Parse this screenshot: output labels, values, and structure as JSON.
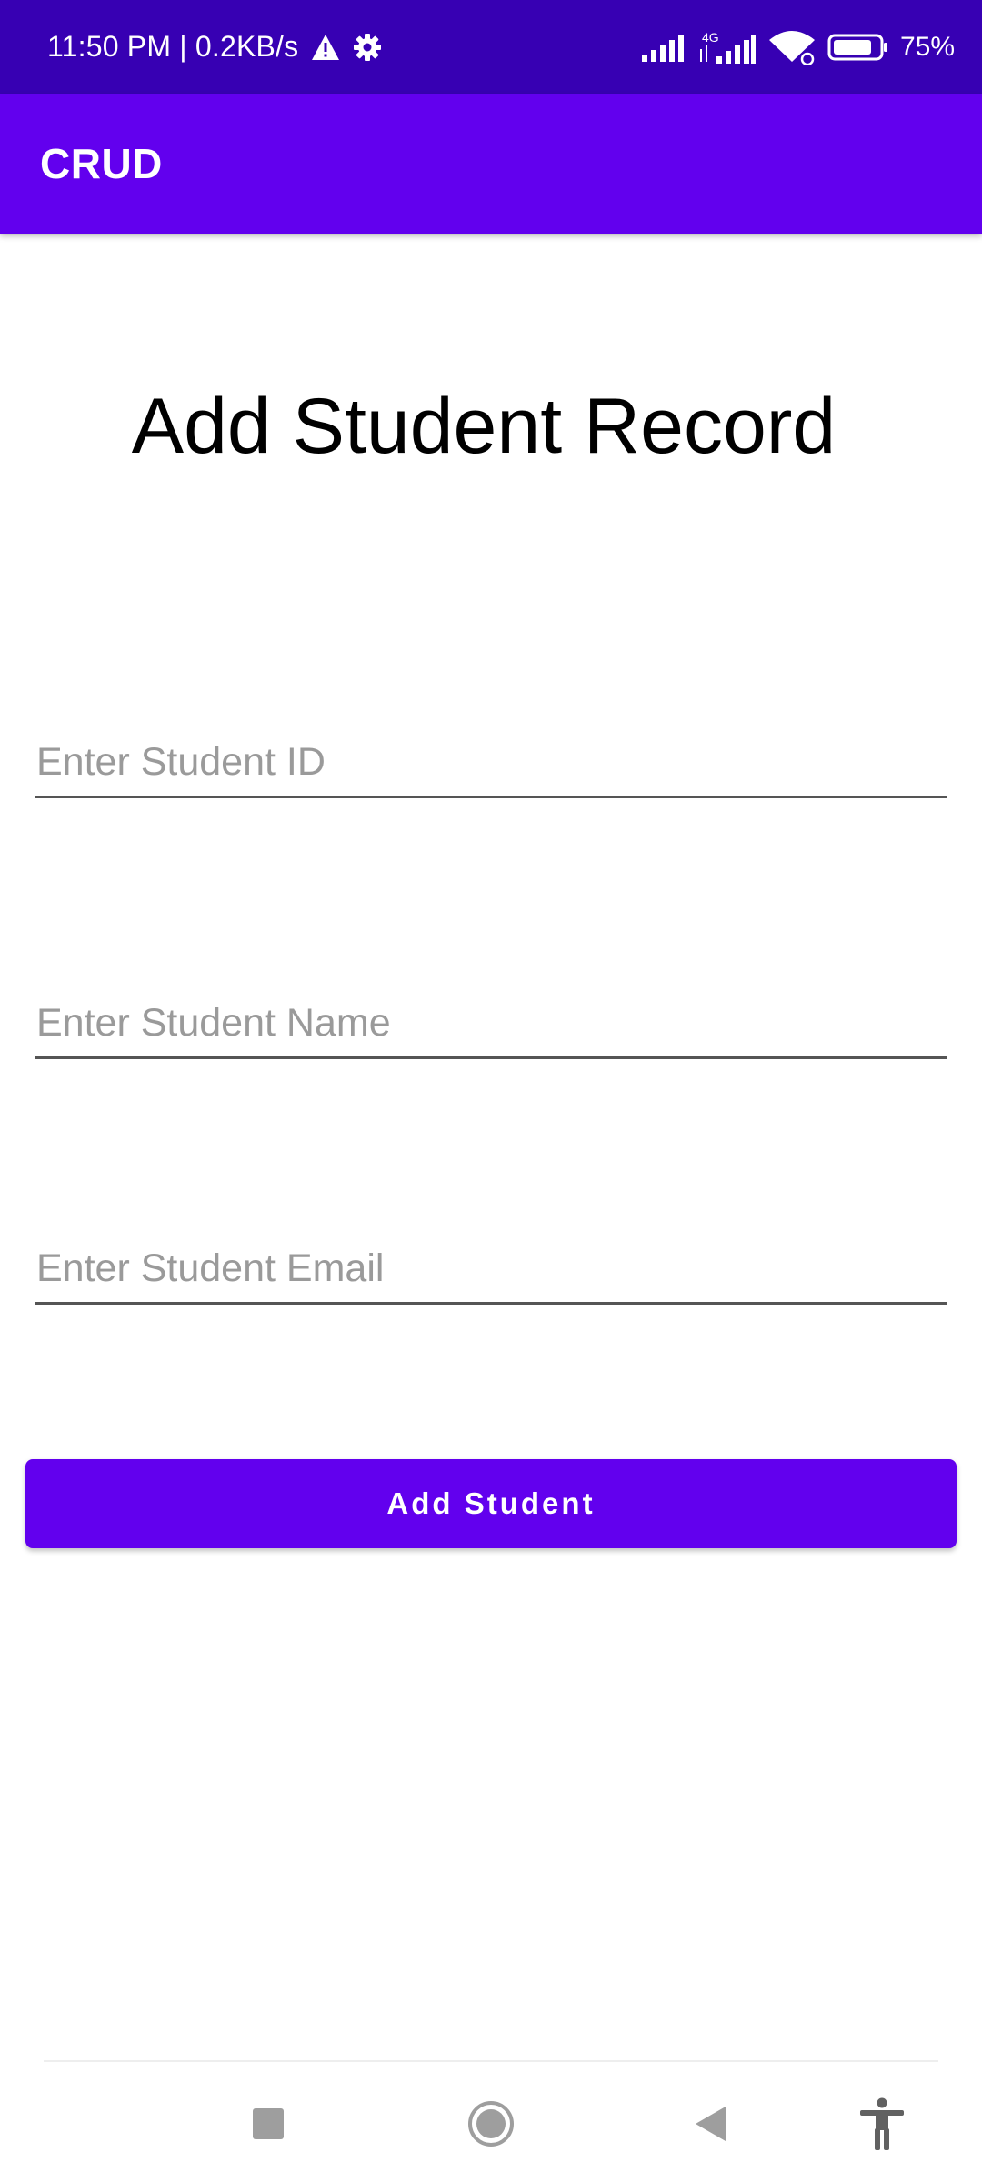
{
  "status_bar": {
    "time_speed": "11:50 PM | 0.2KB/s",
    "network_label": "4G",
    "battery_percent": "75%",
    "icons": [
      "warning-icon",
      "settings-gear-icon",
      "signal-icon",
      "signal-4g-icon",
      "wifi-icon",
      "battery-icon"
    ]
  },
  "app_bar": {
    "title": "CRUD"
  },
  "form": {
    "heading": "Add Student Record",
    "id_placeholder": "Enter Student ID",
    "id_value": "",
    "name_placeholder": "Enter Student Name",
    "name_value": "",
    "email_placeholder": "Enter Student Email",
    "email_value": "",
    "submit_label": "Add Student"
  },
  "nav_bar": {
    "icons": [
      "recents-square-icon",
      "home-circle-icon",
      "back-triangle-icon",
      "accessibility-icon"
    ]
  },
  "colors": {
    "status_bar": "#3700b3",
    "primary": "#6200ee",
    "placeholder": "#9a9a9a"
  }
}
